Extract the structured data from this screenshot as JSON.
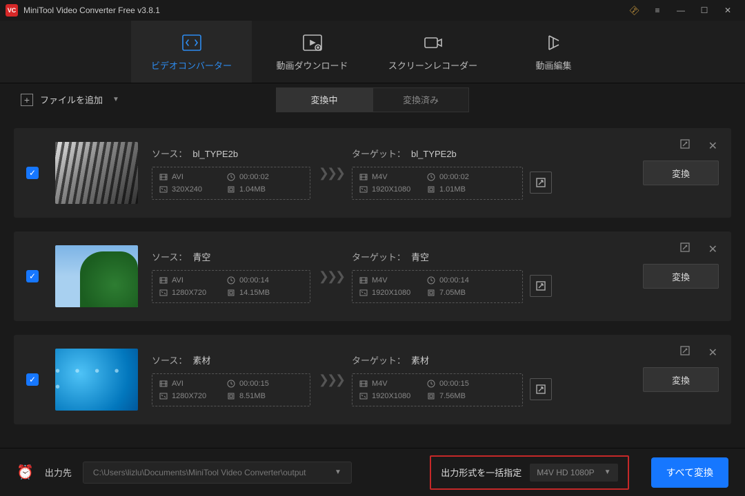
{
  "app": {
    "title": "MiniTool Video Converter Free v3.8.1"
  },
  "tabs": [
    {
      "label": "ビデオコンバーター",
      "active": true
    },
    {
      "label": "動画ダウンロード",
      "active": false
    },
    {
      "label": "スクリーンレコーダー",
      "active": false
    },
    {
      "label": "動画編集",
      "active": false
    }
  ],
  "toolbar": {
    "add_label": "ファイルを追加"
  },
  "status_tabs": {
    "converting": "変換中",
    "done": "変換済み"
  },
  "labels": {
    "source": "ソース：",
    "target": "ターゲット：",
    "convert": "変換"
  },
  "items": [
    {
      "checked": true,
      "thumb": "th1",
      "source": {
        "name": "bl_TYPE2b",
        "fmt": "AVI",
        "dur": "00:00:02",
        "res": "320X240",
        "size": "1.04MB"
      },
      "target": {
        "name": "bl_TYPE2b",
        "fmt": "M4V",
        "dur": "00:00:02",
        "res": "1920X1080",
        "size": "1.01MB"
      }
    },
    {
      "checked": true,
      "thumb": "th2",
      "source": {
        "name": "青空",
        "fmt": "AVI",
        "dur": "00:00:14",
        "res": "1280X720",
        "size": "14.15MB"
      },
      "target": {
        "name": "青空",
        "fmt": "M4V",
        "dur": "00:00:14",
        "res": "1920X1080",
        "size": "7.05MB"
      }
    },
    {
      "checked": true,
      "thumb": "th3",
      "source": {
        "name": "素材",
        "fmt": "AVI",
        "dur": "00:00:15",
        "res": "1280X720",
        "size": "8.51MB"
      },
      "target": {
        "name": "素材",
        "fmt": "M4V",
        "dur": "00:00:15",
        "res": "1920X1080",
        "size": "7.56MB"
      }
    }
  ],
  "footer": {
    "output_label": "出力先",
    "output_path": "C:\\Users\\lizlu\\Documents\\MiniTool Video Converter\\output",
    "batch_label": "出力形式を一括指定",
    "batch_format": "M4V HD 1080P",
    "convert_all": "すべて変換"
  }
}
